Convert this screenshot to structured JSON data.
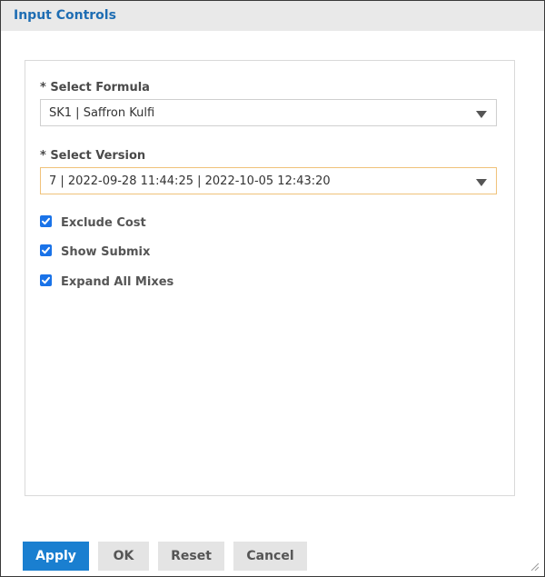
{
  "dialog": {
    "title": "Input Controls"
  },
  "form": {
    "formula": {
      "label": "* Select Formula",
      "value": "SK1 | Saffron Kulfi"
    },
    "version": {
      "label": "* Select Version",
      "value": "7 | 2022-09-28 11:44:25 | 2022-10-05 12:43:20"
    },
    "checkboxes": [
      {
        "label": "Exclude Cost",
        "checked": true
      },
      {
        "label": "Show Submix",
        "checked": true
      },
      {
        "label": "Expand All Mixes",
        "checked": true
      }
    ]
  },
  "buttons": {
    "apply": "Apply",
    "ok": "OK",
    "reset": "Reset",
    "cancel": "Cancel"
  },
  "colors": {
    "title": "#1e6db3",
    "primary_button": "#1a7fd0",
    "checkbox": "#1a73e8",
    "focused_border": "#f0c27a"
  }
}
